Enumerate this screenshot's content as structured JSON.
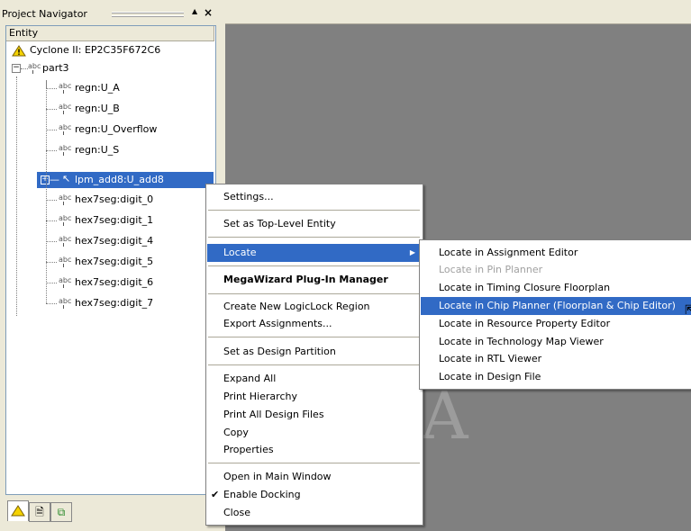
{
  "navigator": {
    "title": "Project Navigator",
    "column_header": "Entity",
    "device": "Cyclone II: EP2C35F672C6",
    "root": "part3",
    "items": [
      "regn:U_A",
      "regn:U_B",
      "regn:U_Overflow",
      "regn:U_S",
      "lpm_add8:U_add8",
      "hex7seg:digit_0",
      "hex7seg:digit_1",
      "hex7seg:digit_4",
      "hex7seg:digit_5",
      "hex7seg:digit_6",
      "hex7seg:digit_7"
    ],
    "selected_item": "lpm_add8:U_add8"
  },
  "context_menu": {
    "settings": "Settings...",
    "set_top": "Set as Top-Level Entity",
    "locate": "Locate",
    "megawizard": "MegaWizard Plug-In Manager",
    "logiclock": "Create New LogicLock Region",
    "export": "Export Assignments...",
    "partition": "Set as Design Partition",
    "expand": "Expand All",
    "print_hier": "Print Hierarchy",
    "print_files": "Print All Design Files",
    "copy": "Copy",
    "properties": "Properties",
    "open_main": "Open in Main Window",
    "docking": "Enable Docking",
    "close": "Close"
  },
  "locate_submenu": {
    "assignment": "Locate in Assignment Editor",
    "pin_planner": "Locate in Pin Planner",
    "timing": "Locate in Timing Closure Floorplan",
    "chip_planner": "Locate in Chip Planner (Floorplan & Chip Editor)",
    "resource": "Locate in Resource Property Editor",
    "techmap": "Locate in Technology Map Viewer",
    "rtl": "Locate in RTL Viewer",
    "design_file": "Locate in Design File"
  },
  "workspace": {
    "watermark": "QUA"
  },
  "colors": {
    "selection": "#316ac5",
    "workspace": "#808080",
    "panel": "#ece9d8"
  }
}
